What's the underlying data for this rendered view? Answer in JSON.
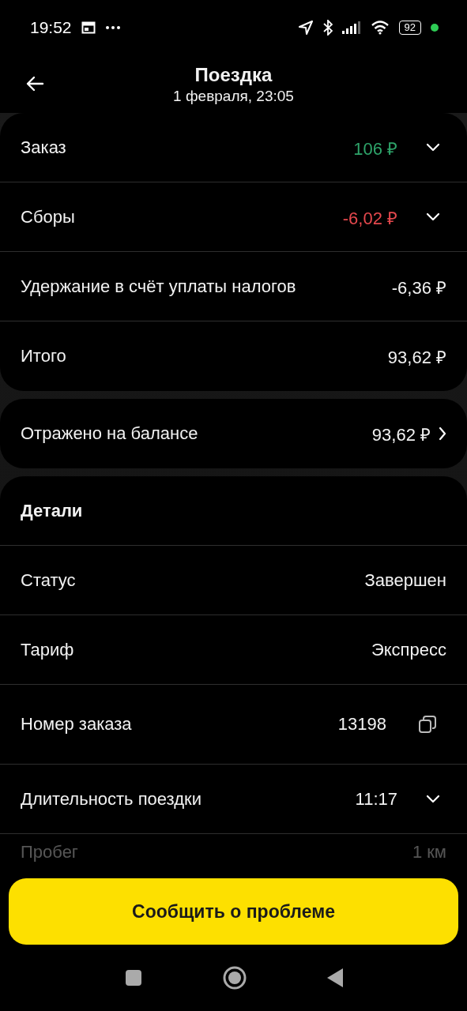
{
  "status_bar": {
    "time": "19:52",
    "battery": "92"
  },
  "header": {
    "title": "Поездка",
    "subtitle": "1 февраля, 23:05"
  },
  "summary": [
    {
      "label": "Заказ",
      "value": "106 ₽",
      "color": "#2ea46a",
      "expandable": true
    },
    {
      "label": "Сборы",
      "value": "-6,02 ₽",
      "color": "#e5484d",
      "expandable": true
    },
    {
      "label": "Удержание в счёт уплаты налогов",
      "value": "-6,36 ₽",
      "color": "#f2f2f2",
      "expandable": false
    },
    {
      "label": "Итого",
      "value": "93,62 ₽",
      "color": "#f2f2f2",
      "expandable": false
    }
  ],
  "balance": {
    "label": "Отражено на балансе",
    "value": "93,62 ₽"
  },
  "details": {
    "title": "Детали",
    "rows": [
      {
        "label": "Статус",
        "value": "Завершен",
        "kind": "plain",
        "faded": false
      },
      {
        "label": "Тариф",
        "value": "Экспресс",
        "kind": "plain",
        "faded": false
      },
      {
        "label": "Номер заказа",
        "value": "13198",
        "kind": "copy",
        "faded": false
      },
      {
        "label": "Длительность поездки",
        "value": "11:17",
        "kind": "expand",
        "faded": false
      },
      {
        "label": "Пробег",
        "value": "1 км",
        "kind": "plain",
        "faded": true
      }
    ]
  },
  "report_button": {
    "label": "Сообщить о проблеме"
  }
}
